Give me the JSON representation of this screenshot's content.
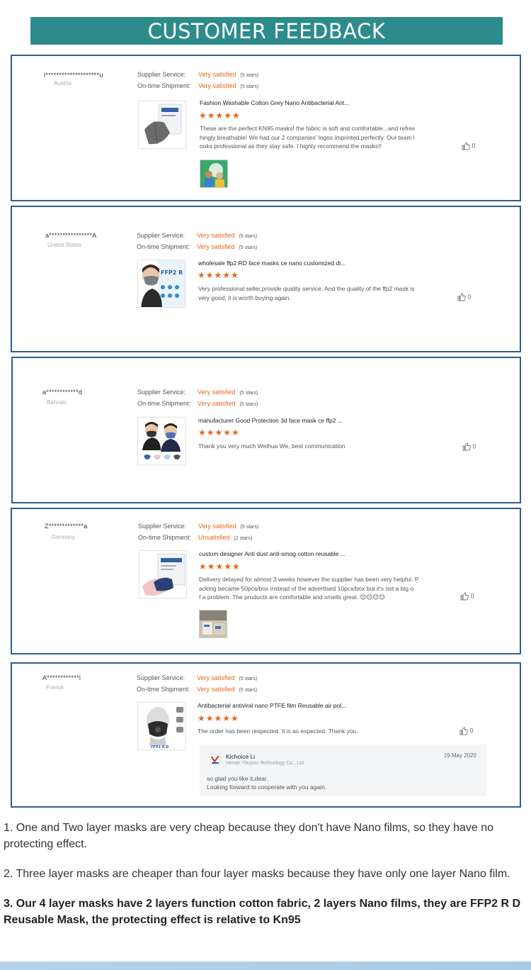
{
  "header": {
    "title": "CUSTOMER FEEDBACK"
  },
  "labels": {
    "supplier_service": "Supplier Service:",
    "ontime_shipment": "On-time Shipment:"
  },
  "reviews": [
    {
      "name": "l********************u",
      "country": "Austria",
      "supplier_rating": "Very satisfied",
      "supplier_stars": "(5 stars)",
      "shipment_rating": "Very satisfied",
      "shipment_stars": "(5 stars)",
      "product_title": "Fashion Washable Cotton Grey Nano Antibacterial Ant...",
      "rating": "★★★★★",
      "review_lines": [
        "These are the perfect KN95 masks! the fabric is soft and comfortable...and refres",
        "hingly breathable! We had our 2 companies' logos imprinted perfectly. Our team l",
        "ooks professional as they stay safe. I highly recommend the masks!!"
      ],
      "likes": "0",
      "icons": [
        "grey-mask-product-thumbnail",
        "customer-photo",
        "thumbs-up-icon"
      ]
    },
    {
      "name": "a****************A",
      "country": "United States",
      "supplier_rating": "Very satisfied",
      "supplier_stars": "(5 stars)",
      "shipment_rating": "Very satisfied",
      "shipment_stars": "(5 stars)",
      "product_title": "wholesale ffp2 RD face masks ce nano customized di...",
      "rating": "★★★★★",
      "product_thumb_text": "FFP2 R D",
      "review_lines": [
        "Very professional seller,provide quality service. And the quality of the ffp2 mask is",
        "very good, it is worth buying again."
      ],
      "likes": "0"
    },
    {
      "name": "a************d",
      "country": "Bahrain",
      "supplier_rating": "Very satisfied",
      "supplier_stars": "(5 stars)",
      "shipment_rating": "Very satisfied",
      "shipment_stars": "(5 stars)",
      "product_title": "manufacturer Good Protection 3d face mask ce ffp2 ...",
      "rating": "★★★★★",
      "review_lines": [
        "Thank you very much Weihua We, best communication"
      ],
      "likes": "0"
    },
    {
      "name": "Z*************a",
      "country": "Germany",
      "supplier_rating": "Very satisfied",
      "supplier_stars": "(5 stars)",
      "shipment_rating": "Unsatisfied",
      "shipment_stars": "(2 stars)",
      "product_title": "custom designer Anti dust anti-smog cotton reusable ...",
      "rating": "★★★★★",
      "review_lines": [
        "Delivery delayed for almost 3 weeks however the supplier has been very helpful. P",
        "acking became 50pcs/box instead of the advertised 10pcs/box but it's not a big o",
        "f a problem. The products are comfortable and smells great. 😊😊😊😊"
      ],
      "likes": "0"
    },
    {
      "name": "A************l",
      "country": "France",
      "supplier_rating": "Very satisfied",
      "supplier_stars": "(5 stars)",
      "shipment_rating": "Very satisfied",
      "shipment_stars": "(5 stars)",
      "product_title": "Antibacterial antiviral nano PTFE film Reusable air pol...",
      "rating": "★★★★★",
      "product_thumb_text": "FFP2 R D",
      "review_lines": [
        "The order has been respected. It is as expected. Thank you."
      ],
      "likes": "0",
      "reply": {
        "name": "Kichoice Li",
        "company": "Henan Ybuyoo Technology Co., Ltd.",
        "date": "19 May 2020",
        "lines": [
          "so glad you like it,dear.",
          "Looking forward to cooperate with you again."
        ]
      }
    }
  ],
  "notes": [
    "1. One and Two layer masks are very cheap because they don't have Nano films, so they have no protecting effect.",
    "2. Three layer masks are cheaper than four layer masks because they have only one layer Nano film.",
    "3. Our 4 layer masks have 2 layers function cotton fabric, 2 layers Nano films, they are FFP2 R D Reusable Mask, the protecting effect is relative to Kn95"
  ],
  "colors": {
    "header_bg": "#2e8b8b",
    "card_border": "#2f5e8c",
    "rating_orange": "#e8651c"
  }
}
